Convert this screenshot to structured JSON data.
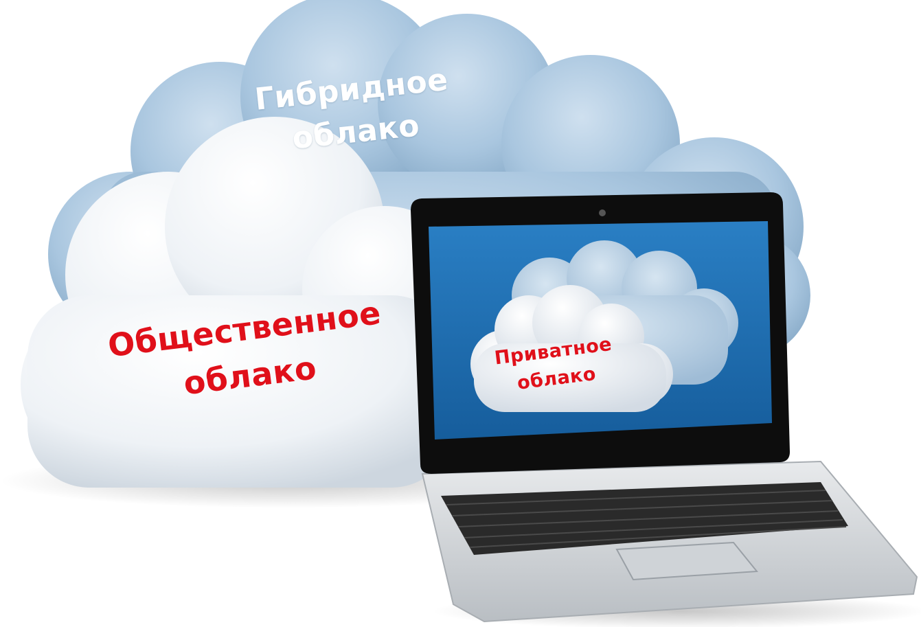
{
  "labels": {
    "hybrid": {
      "line1": "Гибридное",
      "line2": "облако"
    },
    "public": {
      "line1": "Общественное",
      "line2": "облако"
    },
    "private": {
      "line1": "Приватное",
      "line2": "облако"
    }
  },
  "colors": {
    "hybrid_cloud": "#a9c6df",
    "public_cloud": "#eef2f6",
    "private_cloud_back": "#b5cfe3",
    "private_cloud_front": "#f3f5f8",
    "screen": "#1f6fb3",
    "bezel": "#0d0d0d",
    "laptop_base": "#d9dcdf",
    "keyboard": "#2a2a2a",
    "hybrid_text": "#ffffff",
    "accent_text": "#e0101a"
  },
  "icons": {
    "hybrid": "cloud-icon",
    "public": "cloud-icon",
    "laptop": "laptop-icon",
    "private": "cloud-icon"
  }
}
